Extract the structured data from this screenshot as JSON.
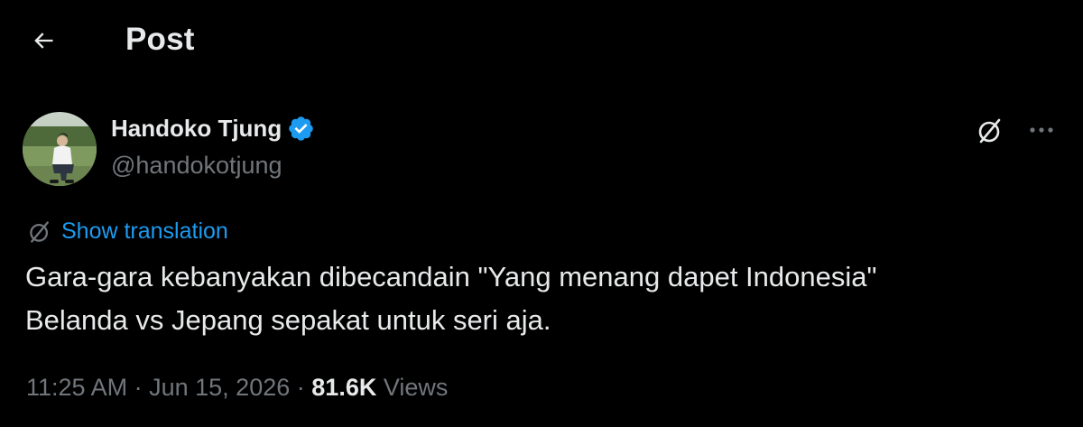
{
  "header": {
    "back_icon": "arrow-left-icon",
    "title": "Post"
  },
  "author": {
    "name": "Handoko Tjung",
    "handle": "@handokotjung",
    "verified_icon": "verified-badge-icon",
    "verified_color": "#1d9bf0"
  },
  "actions": {
    "grok_icon": "grok-icon",
    "more_icon": "more-horizontal-icon"
  },
  "translation": {
    "icon": "grok-icon",
    "label": "Show translation"
  },
  "tweet": {
    "lines": [
      "Gara-gara kebanyakan dibecandain \"Yang menang dapet Indonesia\"",
      "Belanda vs Jepang sepakat untuk seri aja."
    ]
  },
  "meta": {
    "time": "11:25 AM",
    "separator": "·",
    "date": "Jun 15, 2026",
    "views_count": "81.6K",
    "views_label": "Views"
  },
  "colors": {
    "background": "#000000",
    "text_primary": "#e7e9ea",
    "text_secondary": "#71767b",
    "accent": "#1d9bf0"
  }
}
